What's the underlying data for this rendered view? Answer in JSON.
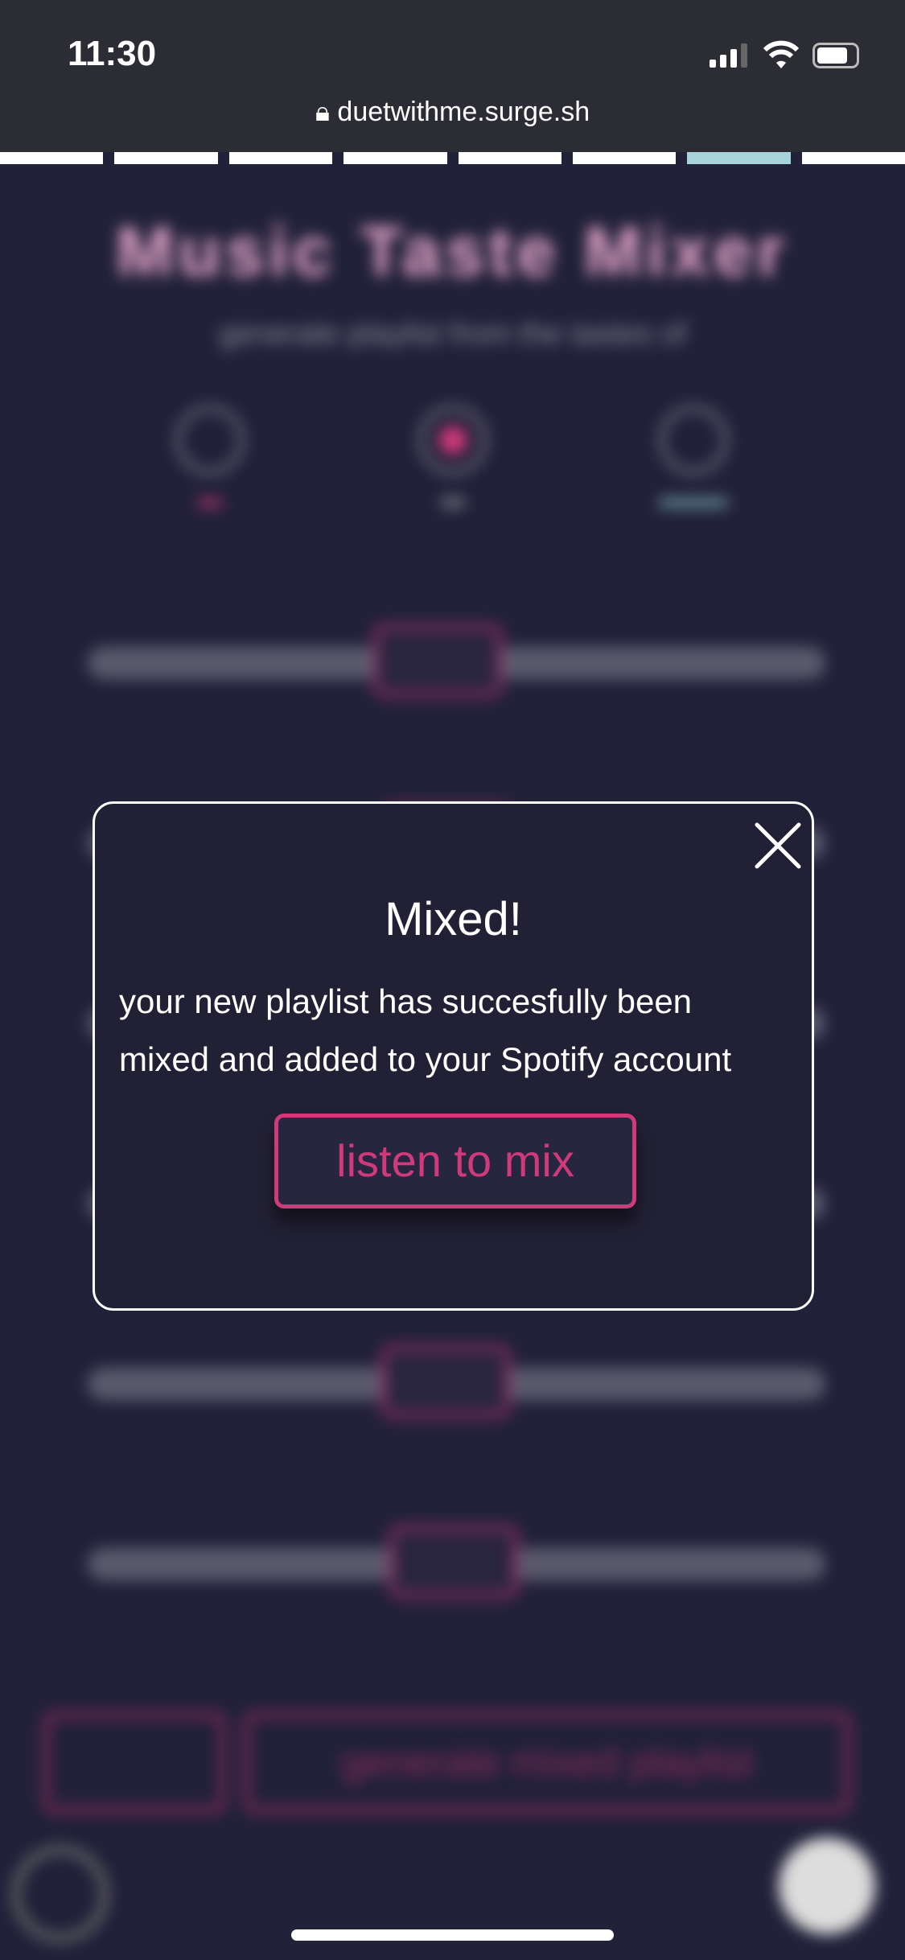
{
  "status_bar": {
    "time": "11:30",
    "url": "duetwithme.surge.sh"
  },
  "progress": {
    "segments": 8,
    "active_index": 6,
    "active_color": "#a7d3da"
  },
  "background": {
    "title": "Music Taste Mixer",
    "subtitle": "generate playlist from the tastes of",
    "generate_label": "generate mixed playlist"
  },
  "modal": {
    "title": "Mixed!",
    "message": "your new playlist has succesfully been mixed and added to your Spotify account",
    "button_label": "listen to mix",
    "accent": "#d03a7a"
  }
}
